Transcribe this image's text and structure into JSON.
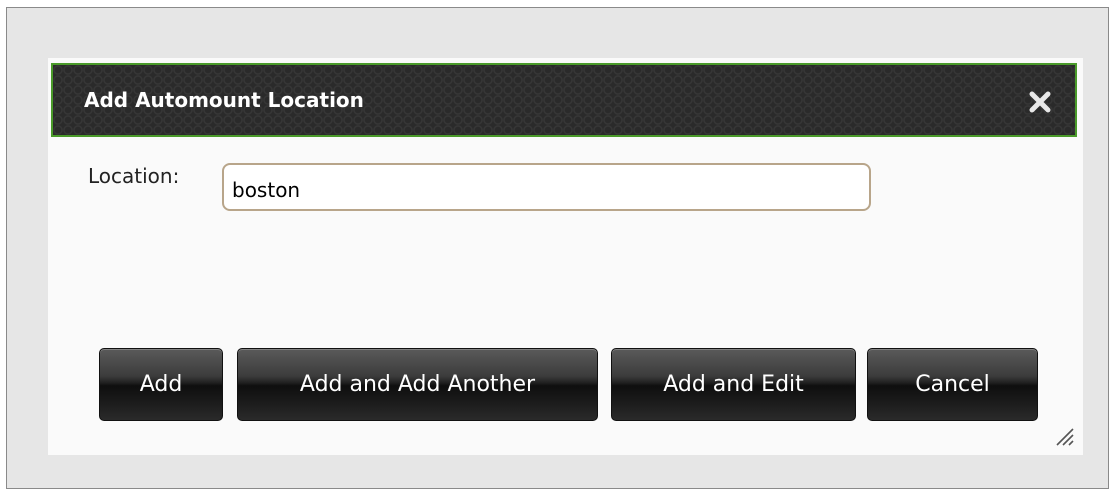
{
  "dialog": {
    "title": "Add Automount Location",
    "close_icon": "close-icon"
  },
  "form": {
    "location_label": "Location:",
    "location_value": "boston"
  },
  "buttons": {
    "add": "Add",
    "add_another": "Add and Add Another",
    "add_edit": "Add and Edit",
    "cancel": "Cancel"
  },
  "colors": {
    "titlebar_background": "#2a2a2a",
    "titlebar_border": "#4a9a2a",
    "button_background": "#1f1f1f",
    "dialog_background": "#fafafa"
  }
}
